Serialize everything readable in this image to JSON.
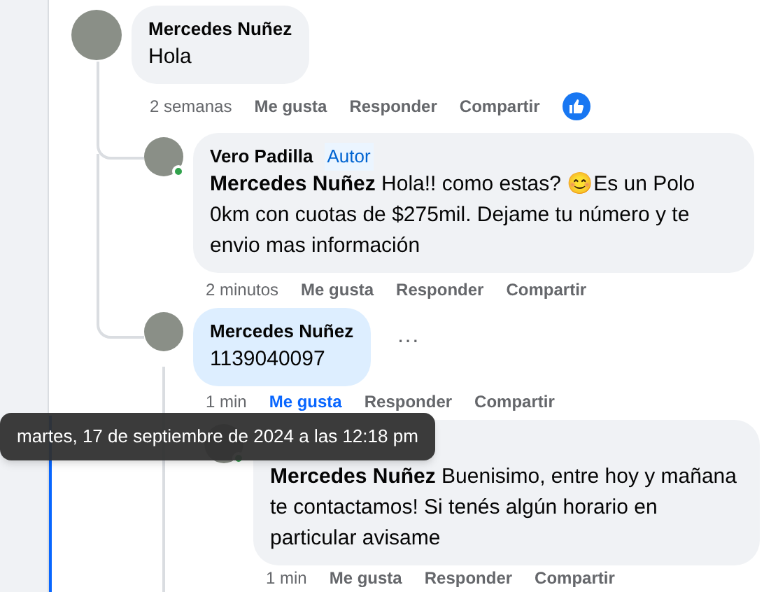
{
  "comments": [
    {
      "author": "Mercedes Nuñez",
      "text": "Hola",
      "online": false,
      "highlighted": false,
      "liked": false,
      "reacted": true,
      "time": "2 semanas",
      "actions": [
        "Me gusta",
        "Responder",
        "Compartir"
      ]
    },
    {
      "author": "Vero Padilla",
      "badge": "Autor",
      "text": "**Mercedes Nuñez** Hola!! como estas? 😊Es un Polo 0km con cuotas de $275mil. Dejame tu número y te envio mas información",
      "online": true,
      "highlighted": false,
      "liked": false,
      "reacted": false,
      "time": "2 minutos",
      "actions": [
        "Me gusta",
        "Responder",
        "Compartir"
      ]
    },
    {
      "author": "Mercedes Nuñez",
      "text": "1139040097",
      "online": false,
      "highlighted": true,
      "more": "···",
      "liked": true,
      "reacted": false,
      "time": "1 min",
      "actions": [
        "Me gusta",
        "Responder",
        "Compartir"
      ]
    },
    {
      "text": "**Mercedes Nuñez** Buenisimo, entre hoy y mañana te contactamos! Si tenés algún horario en particular avisame",
      "online": true,
      "highlighted": false,
      "liked": false,
      "reacted": false,
      "time": "1 min",
      "actions": [
        "Me gusta",
        "Responder",
        "Compartir"
      ]
    }
  ],
  "tooltip": {
    "text": "martes, 17 de septiembre de 2024 a las 12:18 pm"
  }
}
